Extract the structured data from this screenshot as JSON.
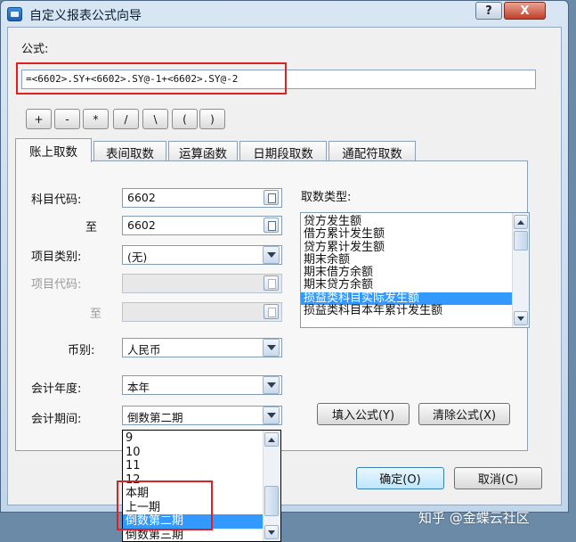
{
  "window": {
    "title": "自定义报表公式向导",
    "help_label": "?",
    "close_label": "X"
  },
  "formula": {
    "label": "公式:",
    "value": "=<6602>.SY+<6602>.SY@-1+<6602>.SY@-2"
  },
  "operators": [
    "+",
    "-",
    "*",
    "/",
    "\\",
    "(",
    ")"
  ],
  "tabs": [
    "账上取数",
    "表间取数",
    "运算函数",
    "日期段取数",
    "通配符取数"
  ],
  "active_tab": 0,
  "form": {
    "account_code_label": "科目代码:",
    "account_code_from": "6602",
    "to_label": "至",
    "account_code_to": "6602",
    "item_category_label": "项目类别:",
    "item_category_value": "(无)",
    "item_code_label": "项目代码:",
    "item_to_label": "至",
    "currency_label": "币别:",
    "currency_value": "人民币",
    "fiscal_year_label": "会计年度:",
    "fiscal_year_value": "本年",
    "period_label": "会计期间:",
    "period_value": "倒数第二期"
  },
  "fetch_type": {
    "label": "取数类型:",
    "options": [
      "贷方发生额",
      "借方累计发生额",
      "贷方累计发生额",
      "期末余额",
      "期末借方余额",
      "期末贷方余额",
      "损益类科目实际发生额",
      "损益类科目本年累计发生额"
    ],
    "selected_index": 6
  },
  "buttons": {
    "fill_formula": "填入公式(Y)",
    "clear_formula": "清除公式(X)",
    "ok": "确定(O)",
    "cancel": "取消(C)"
  },
  "period_dropdown": {
    "options": [
      "9",
      "10",
      "11",
      "12",
      "本期",
      "上一期",
      "倒数第二期",
      "倒数第三期"
    ],
    "selected_index": 6
  },
  "watermark": "知乎 @金蝶云社区",
  "colors": {
    "highlight": "#3399ff",
    "annotation_red": "#e02020"
  }
}
